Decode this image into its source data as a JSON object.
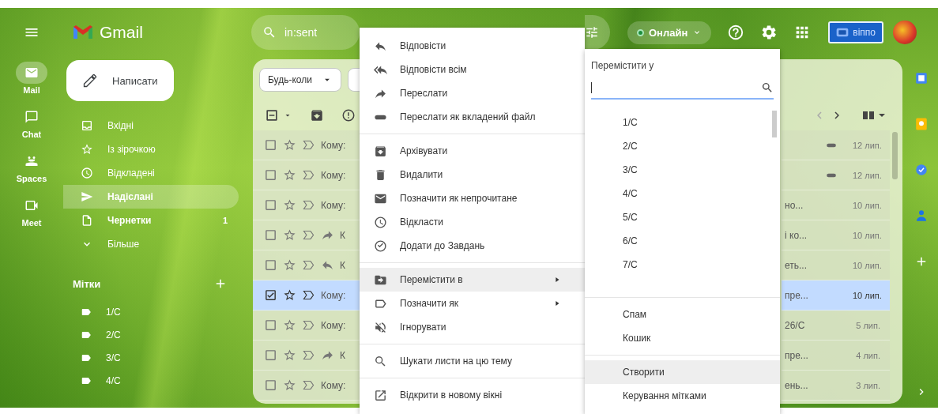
{
  "app": {
    "name": "Gmail"
  },
  "rail": [
    {
      "label": "Mail",
      "kind": "mail",
      "selected": true
    },
    {
      "label": "Chat",
      "kind": "chat",
      "selected": false
    },
    {
      "label": "Spaces",
      "kind": "spaces",
      "selected": false
    },
    {
      "label": "Meet",
      "kind": "meet",
      "selected": false
    }
  ],
  "search": {
    "value": "in:sent"
  },
  "status": {
    "label": "Онлайн",
    "online": true
  },
  "account_button": {
    "label": "віппо"
  },
  "compose": {
    "label": "Написати"
  },
  "nav": [
    {
      "label": "Вхідні",
      "kind": "inbox",
      "selected": false,
      "bold": false
    },
    {
      "label": "Із зірочкою",
      "kind": "star",
      "selected": false,
      "bold": false
    },
    {
      "label": "Відкладені",
      "kind": "clock",
      "selected": false,
      "bold": false
    },
    {
      "label": "Надіслані",
      "kind": "send",
      "selected": true,
      "bold": true
    },
    {
      "label": "Чернетки",
      "kind": "draft",
      "selected": false,
      "bold": true,
      "count": "1"
    },
    {
      "label": "Більше",
      "kind": "more",
      "selected": false,
      "bold": false
    }
  ],
  "labels": {
    "title": "Мітки",
    "items": [
      "1/C",
      "2/C",
      "3/C",
      "4/C"
    ]
  },
  "filters": [
    {
      "label": "Будь-коли"
    }
  ],
  "rows": [
    {
      "selected": false,
      "starred": false,
      "kind": "plain",
      "recipient": "Кому:",
      "attachment": true,
      "date": "12 лип."
    },
    {
      "selected": false,
      "starred": false,
      "kind": "plain",
      "recipient": "Кому:",
      "attachment": true,
      "date": "12 лип."
    },
    {
      "selected": false,
      "starred": false,
      "kind": "plain",
      "recipient": "Кому:",
      "snippet": "но...",
      "attachment": false,
      "date": "10 лип."
    },
    {
      "selected": false,
      "starred": false,
      "kind": "forwarded",
      "recipient": "К",
      "snippet": "і ко...",
      "attachment": false,
      "date": "10 лип."
    },
    {
      "selected": false,
      "starred": false,
      "kind": "replied",
      "recipient": "К",
      "snippet": "еть...",
      "attachment": false,
      "date": "10 лип."
    },
    {
      "selected": true,
      "starred": false,
      "kind": "plain",
      "recipient": "Кому:",
      "snippet": "пре...",
      "attachment": false,
      "date": "10 лип."
    },
    {
      "selected": false,
      "starred": false,
      "kind": "plain",
      "recipient": "Кому:",
      "snippet": "26/C",
      "attachment": false,
      "date": "5 лип."
    },
    {
      "selected": false,
      "starred": false,
      "kind": "forwarded",
      "recipient": "К",
      "snippet": "пре...",
      "attachment": false,
      "date": "4 лип."
    },
    {
      "selected": false,
      "starred": false,
      "kind": "plain",
      "recipient": "Кому:",
      "snippet": "ень...",
      "attachment": false,
      "date": "3 лип."
    }
  ],
  "context_menu": [
    [
      {
        "kind": "reply",
        "label": "Відповісти",
        "selected": false,
        "submenu": false
      },
      {
        "kind": "reply_all",
        "label": "Відповісти всім",
        "selected": false,
        "submenu": false
      },
      {
        "kind": "forward",
        "label": "Переслати",
        "selected": false,
        "submenu": false
      },
      {
        "kind": "attachment",
        "label": "Переслати як вкладений файл",
        "selected": false,
        "submenu": false
      }
    ],
    [
      {
        "kind": "archive",
        "label": "Архівувати",
        "selected": false,
        "submenu": false
      },
      {
        "kind": "delete",
        "label": "Видалити",
        "selected": false,
        "submenu": false
      },
      {
        "kind": "mail",
        "label": "Позначити як непрочитане",
        "selected": false,
        "submenu": false
      },
      {
        "kind": "clock",
        "label": "Відкласти",
        "selected": false,
        "submenu": false
      },
      {
        "kind": "task",
        "label": "Додати до Завдань",
        "selected": false,
        "submenu": false
      }
    ],
    [
      {
        "kind": "move",
        "label": "Перемістити в",
        "selected": true,
        "submenu": true
      },
      {
        "kind": "label",
        "label": "Позначити як",
        "selected": false,
        "submenu": true
      },
      {
        "kind": "mute",
        "label": "Ігнорувати",
        "selected": false,
        "submenu": false
      }
    ],
    [
      {
        "kind": "search",
        "label": "Шукати листи на цю тему",
        "selected": false,
        "submenu": false
      }
    ],
    [
      {
        "kind": "open",
        "label": "Відкрити в новому вікні",
        "selected": false,
        "submenu": false
      }
    ]
  ],
  "move_menu": {
    "title": "Перемістити у",
    "folders": [
      "1/C",
      "2/C",
      "3/C",
      "4/C",
      "5/C",
      "6/C",
      "7/C"
    ],
    "system": [
      "Спам",
      "Кошик"
    ],
    "actions": [
      {
        "label": "Створити",
        "selected": true
      },
      {
        "label": "Керування мітками",
        "selected": false
      }
    ]
  }
}
